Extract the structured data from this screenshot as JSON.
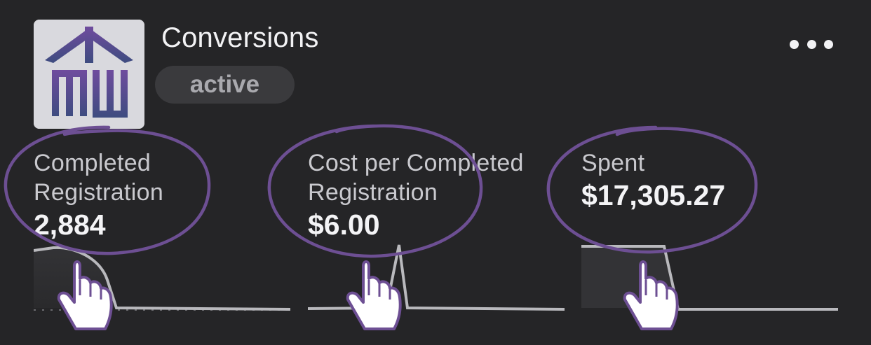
{
  "header": {
    "title": "Conversions",
    "status": "active",
    "more_icon": "more-horizontal-icon"
  },
  "logo": {
    "icon": "building-mw-logo",
    "colors": [
      "#6a4a9a",
      "#3e4a7d"
    ]
  },
  "metrics": [
    {
      "label_line1": "Completed",
      "label_line2": "Registration",
      "value": "2,884"
    },
    {
      "label_line1": "Cost per Completed",
      "label_line2": "Registration",
      "value": "$6.00"
    },
    {
      "label_line1": "Spent",
      "label_line2": "",
      "value": "$17,305.27"
    }
  ],
  "annotation_color": "#6d4f93",
  "hand_icon": "pointing-hand-icon"
}
